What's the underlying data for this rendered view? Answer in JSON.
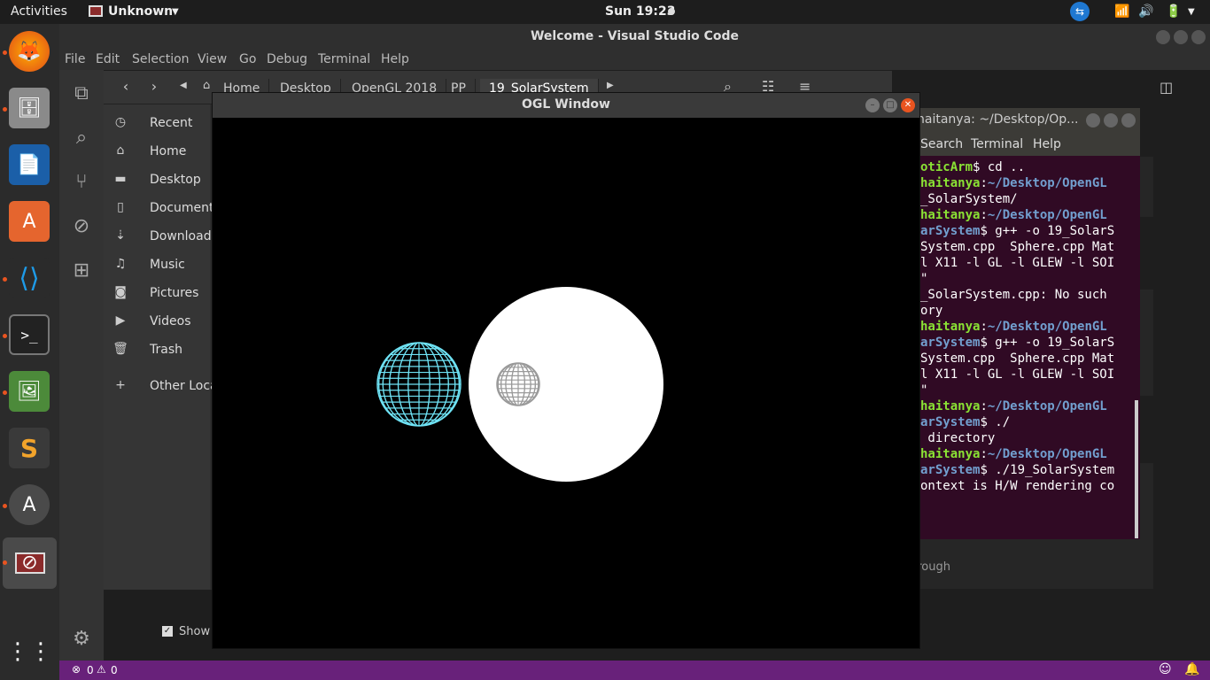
{
  "topbar": {
    "activities": "Activities",
    "app_name": "Unknown",
    "clock": "Sun 19:23"
  },
  "vscode": {
    "title": "Welcome - Visual Studio Code",
    "menu": [
      "File",
      "Edit",
      "Selection",
      "View",
      "Go",
      "Debug",
      "Terminal",
      "Help"
    ],
    "bg_text": "hrough",
    "show_label": "Show",
    "status_errors": "0",
    "status_warnings": "0"
  },
  "files": {
    "breadcrumbs": [
      "Home",
      "Desktop",
      "OpenGL 2018",
      "PP",
      "19_SolarSystem"
    ],
    "sidebar": [
      {
        "icon": "clock-icon",
        "label": "Recent"
      },
      {
        "icon": "home-icon",
        "label": "Home"
      },
      {
        "icon": "folder-icon",
        "label": "Desktop"
      },
      {
        "icon": "document-icon",
        "label": "Document"
      },
      {
        "icon": "download-icon",
        "label": "Downloads"
      },
      {
        "icon": "music-icon",
        "label": "Music"
      },
      {
        "icon": "camera-icon",
        "label": "Pictures"
      },
      {
        "icon": "video-icon",
        "label": "Videos"
      },
      {
        "icon": "trash-icon",
        "label": "Trash"
      },
      {
        "icon": "plus-icon",
        "label": "Other Loca"
      }
    ]
  },
  "terminal": {
    "title": "haitanya: ~/Desktop/Op...",
    "menu": [
      "Search",
      "Terminal",
      "Help"
    ],
    "lines": [
      [
        {
          "c": "g",
          "t": "oticArm"
        },
        {
          "c": "w",
          "t": "$ cd .."
        }
      ],
      [
        {
          "c": "g",
          "t": "haitanya"
        },
        {
          "c": "w",
          "t": ":"
        },
        {
          "c": "b",
          "t": "~/Desktop/OpenGL"
        }
      ],
      [
        {
          "c": "w",
          "t": "_SolarSystem/"
        }
      ],
      [
        {
          "c": "g",
          "t": "haitanya"
        },
        {
          "c": "w",
          "t": ":"
        },
        {
          "c": "b",
          "t": "~/Desktop/OpenGL"
        }
      ],
      [
        {
          "c": "b",
          "t": "arSystem"
        },
        {
          "c": "w",
          "t": "$ g++ -o 19_SolarS"
        }
      ],
      [
        {
          "c": "w",
          "t": "System.cpp  Sphere.cpp Mat"
        }
      ],
      [
        {
          "c": "w",
          "t": "l X11 -l GL -l GLEW -l SOI"
        }
      ],
      [
        {
          "c": "w",
          "t": "\""
        }
      ],
      [
        {
          "c": "w",
          "t": "_SolarSystem.cpp: No such"
        }
      ],
      [
        {
          "c": "w",
          "t": "ory"
        }
      ],
      [
        {
          "c": "g",
          "t": "haitanya"
        },
        {
          "c": "w",
          "t": ":"
        },
        {
          "c": "b",
          "t": "~/Desktop/OpenGL"
        }
      ],
      [
        {
          "c": "b",
          "t": "arSystem"
        },
        {
          "c": "w",
          "t": "$ g++ -o 19_SolarS"
        }
      ],
      [
        {
          "c": "w",
          "t": "System.cpp  Sphere.cpp Mat"
        }
      ],
      [
        {
          "c": "w",
          "t": "l X11 -l GL -l GLEW -l SOI"
        }
      ],
      [
        {
          "c": "w",
          "t": "\""
        }
      ],
      [
        {
          "c": "g",
          "t": "haitanya"
        },
        {
          "c": "w",
          "t": ":"
        },
        {
          "c": "b",
          "t": "~/Desktop/OpenGL"
        }
      ],
      [
        {
          "c": "b",
          "t": "arSystem"
        },
        {
          "c": "w",
          "t": "$ ./"
        }
      ],
      [
        {
          "c": "w",
          "t": " directory"
        }
      ],
      [
        {
          "c": "g",
          "t": "haitanya"
        },
        {
          "c": "w",
          "t": ":"
        },
        {
          "c": "b",
          "t": "~/Desktop/OpenGL"
        }
      ],
      [
        {
          "c": "b",
          "t": "arSystem"
        },
        {
          "c": "w",
          "t": "$ ./19_SolarSystem"
        }
      ],
      [
        {
          "c": "w",
          "t": ""
        }
      ],
      [
        {
          "c": "w",
          "t": "ontext is H/W rendering co"
        }
      ]
    ]
  },
  "ogl": {
    "title": "OGL Window",
    "sun_color": "#ffffff",
    "planet_color": "#6fe3f5",
    "moon_color": "#9a9a9a"
  },
  "colors": {
    "statusbar": "#68217a",
    "terminal_bg": "#300a24",
    "accent": "#e95420"
  }
}
